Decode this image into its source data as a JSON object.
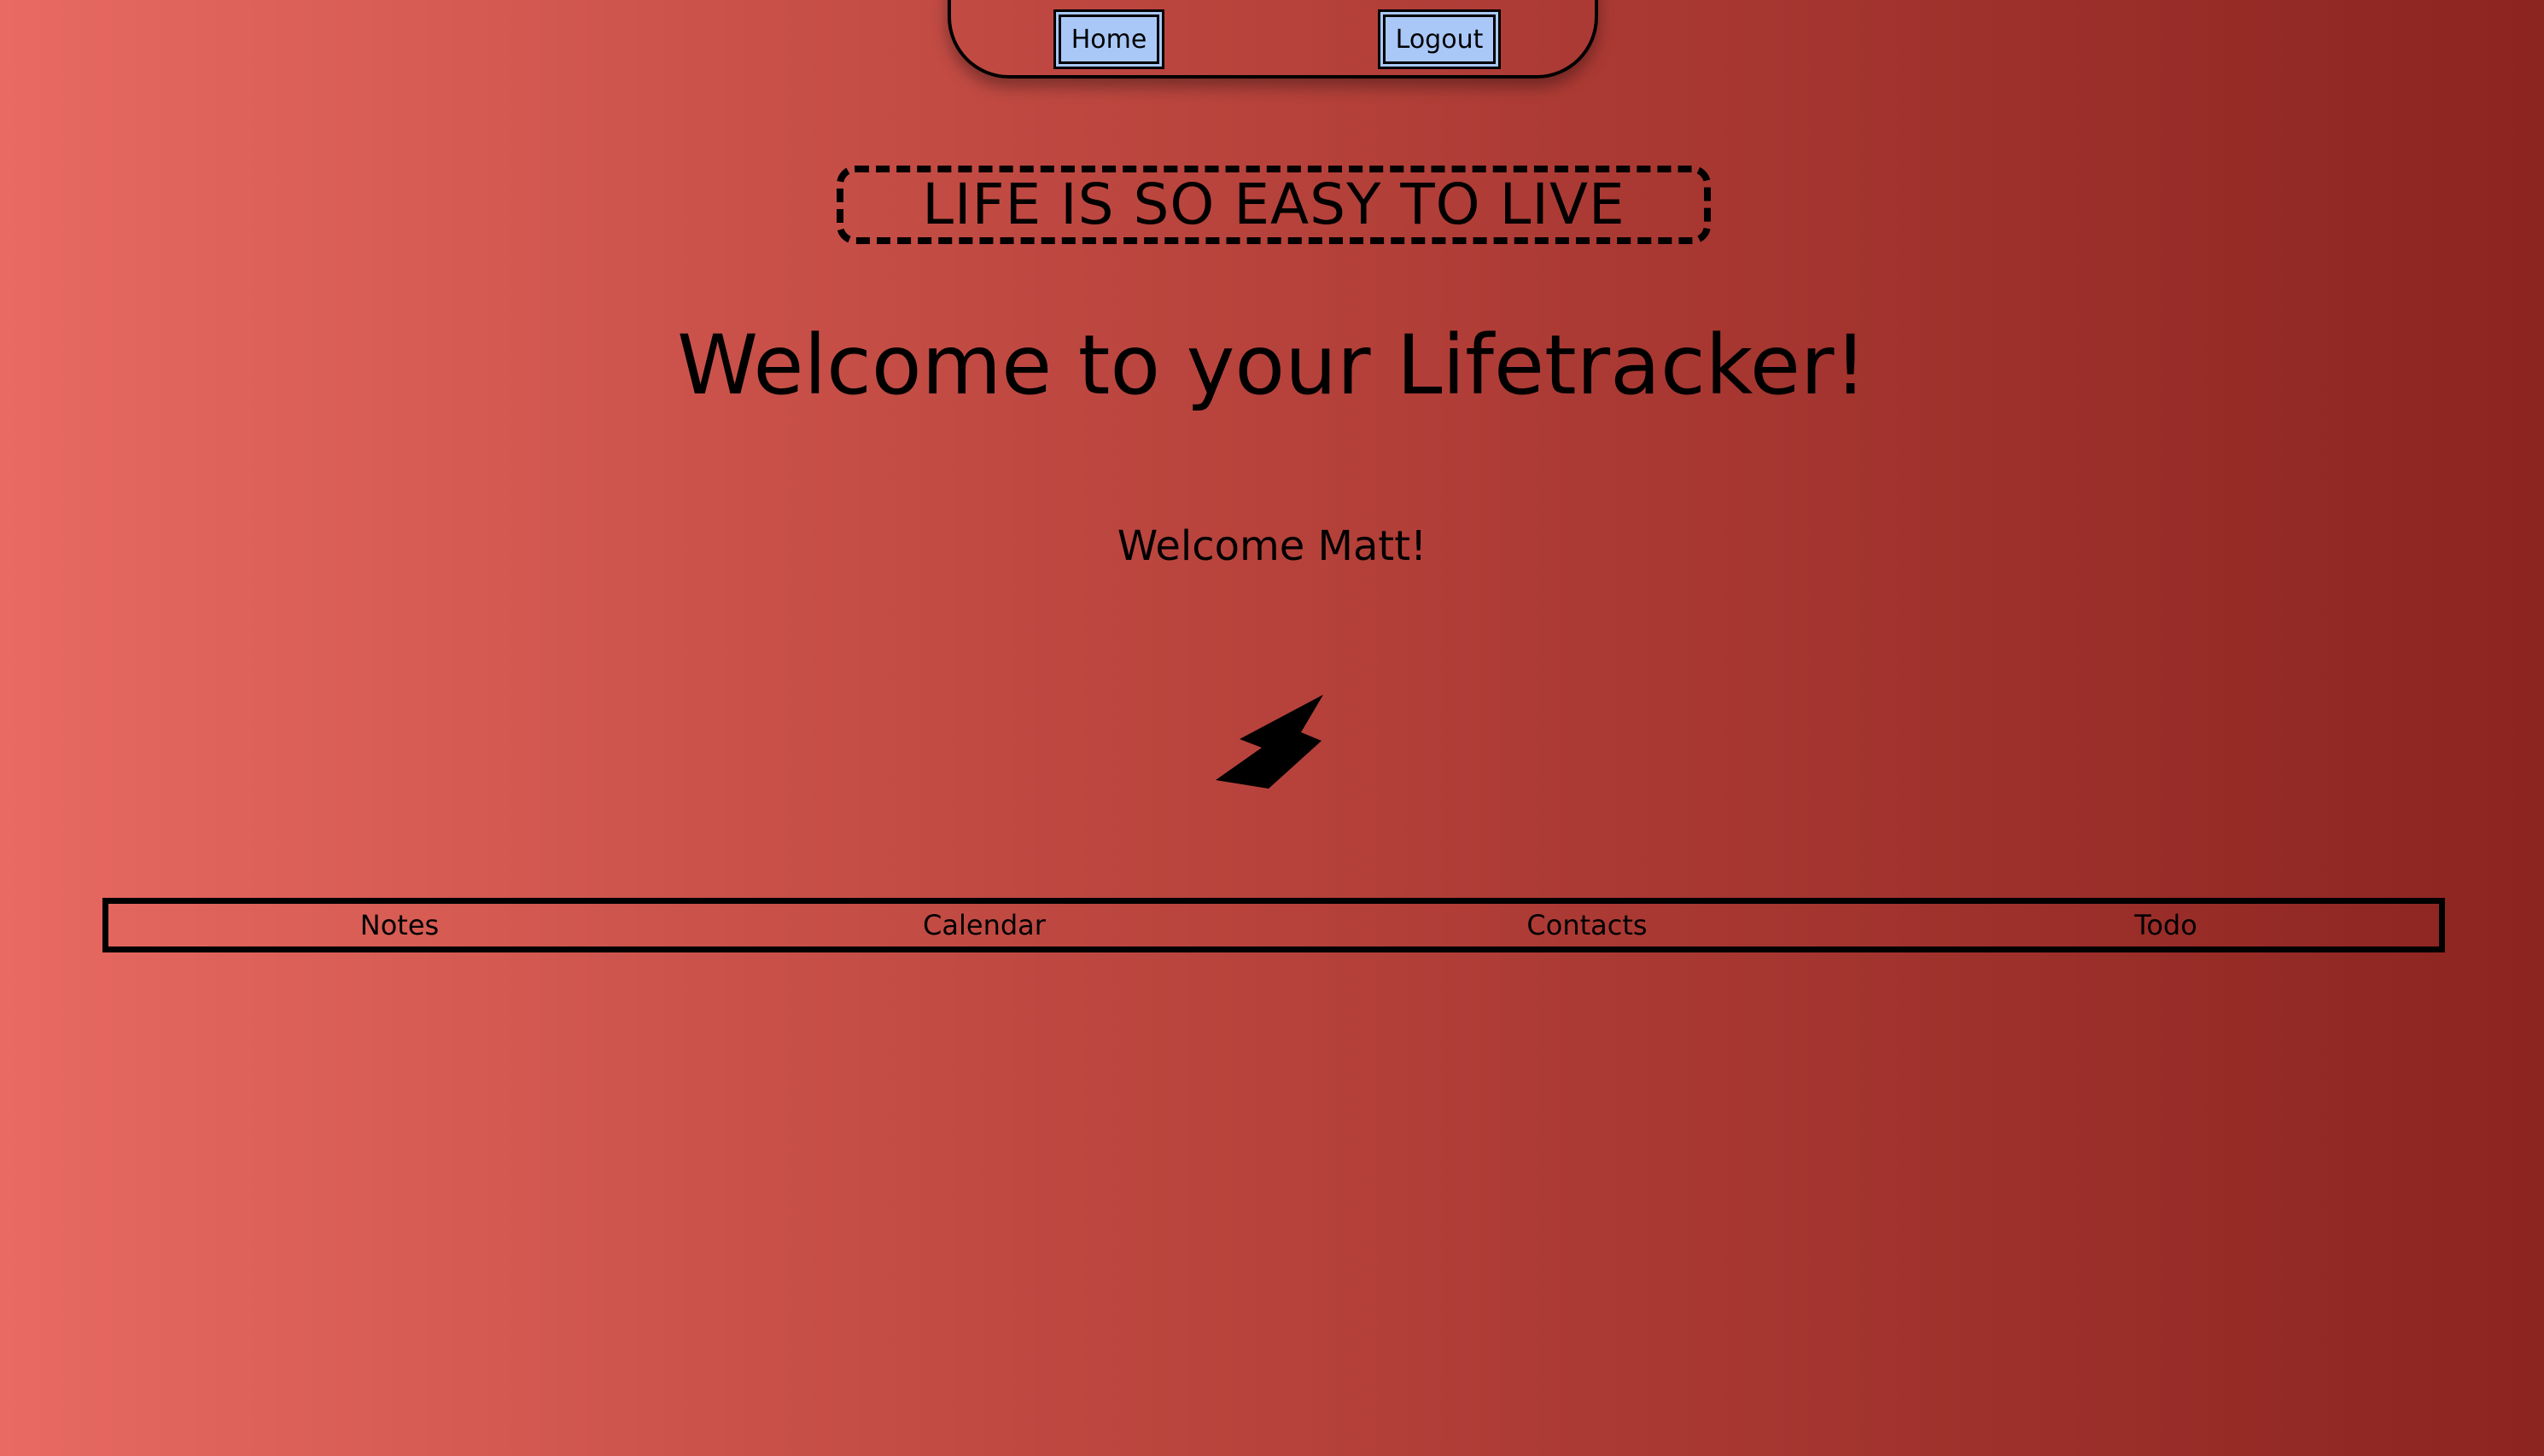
{
  "nav": {
    "home_label": "Home",
    "logout_label": "Logout"
  },
  "motto": "LIFE IS SO EASY TO LIVE",
  "title": "Welcome to your Lifetracker!",
  "greeting": "Welcome Matt!",
  "logo_icon": "lightning-bolt-icon",
  "apps": [
    {
      "label": "Notes"
    },
    {
      "label": "Calendar"
    },
    {
      "label": "Contacts"
    },
    {
      "label": "Todo"
    }
  ],
  "colors": {
    "background_start": "#e86a62",
    "background_end": "#8c2420",
    "button_fill": "#a9c8f8",
    "text": "#000000"
  }
}
